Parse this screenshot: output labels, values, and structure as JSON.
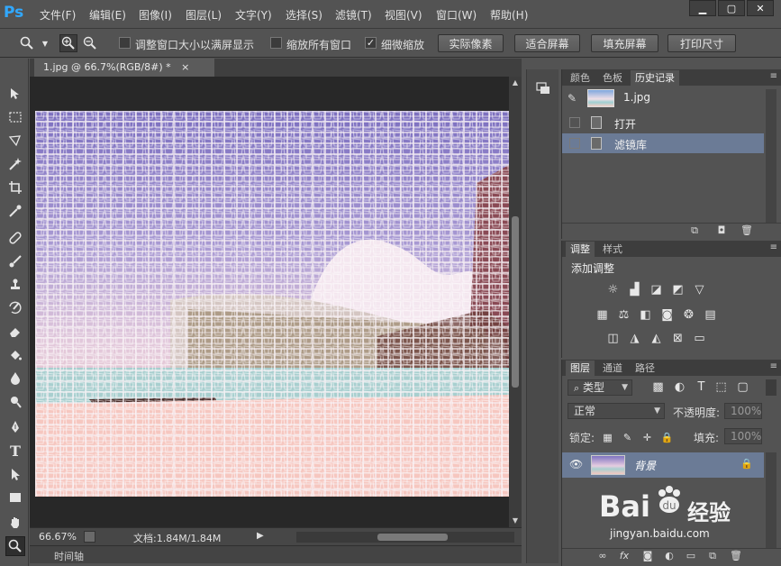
{
  "app": {
    "logo": "Ps"
  },
  "menu": [
    "文件(F)",
    "编辑(E)",
    "图像(I)",
    "图层(L)",
    "文字(Y)",
    "选择(S)",
    "滤镜(T)",
    "视图(V)",
    "窗口(W)",
    "帮助(H)"
  ],
  "window_controls": {
    "minimize": "▁",
    "maximize": "▢",
    "close": "✕"
  },
  "options": {
    "resize_windows": {
      "label": "调整窗口大小以满屏显示",
      "checked": false
    },
    "zoom_all": {
      "label": "缩放所有窗口",
      "checked": false
    },
    "scrubby_zoom": {
      "label": "细微缩放",
      "checked": true
    },
    "check_mark": "✓",
    "buttons": [
      "实际像素",
      "适合屏幕",
      "填充屏幕",
      "打印尺寸"
    ]
  },
  "document": {
    "tab_title": "1.jpg @ 66.7%(RGB/8#) *",
    "close": "×",
    "zoom": "66.67%",
    "doc_info": "文档:1.84M/1.84M",
    "timeline": "时间轴"
  },
  "history_panel": {
    "tabs": [
      "颜色",
      "色板",
      "历史记录"
    ],
    "active_tab": "历史记录",
    "snapshot": "1.jpg",
    "items": [
      "打开",
      "滤镜库"
    ],
    "selected": "滤镜库"
  },
  "adjustments_panel": {
    "tabs": [
      "调整",
      "样式"
    ],
    "heading": "添加调整"
  },
  "layers_panel": {
    "tabs": [
      "图层",
      "通道",
      "路径"
    ],
    "filter_kind": "类型",
    "blend_mode": "正常",
    "opacity_label": "不透明度:",
    "opacity_value": "100%",
    "lock_label": "锁定:",
    "fill_label": "填充:",
    "fill_value": "100%",
    "layer_name": "背景"
  },
  "watermark": {
    "brand": "Bai",
    "brand_cn": "经验",
    "url": "jingyan.baidu.com"
  },
  "colors": {
    "accent": "#31a8ff",
    "selection": "#6b7b96"
  }
}
